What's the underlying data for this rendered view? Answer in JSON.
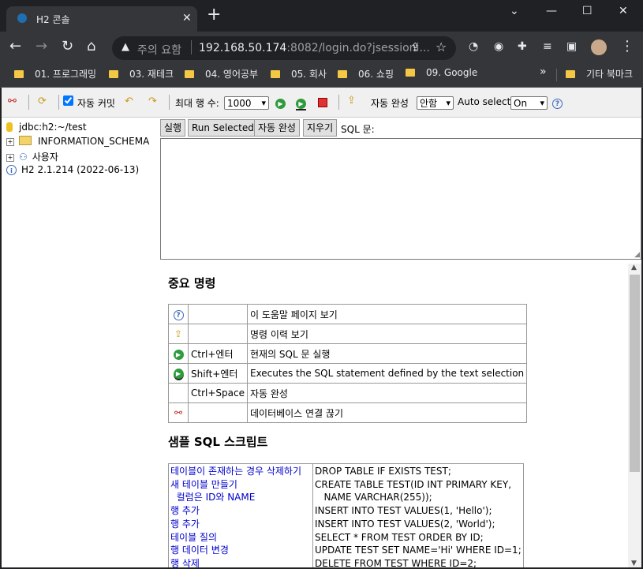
{
  "browser": {
    "tab_title": "H2 콘솔",
    "url_prefix": "주의 요함",
    "url_host": "192.168.50.174",
    "url_rest": ":8082/login.do?jsessioni...",
    "bookmarks": [
      "01. 프로그래밍",
      "03. 재테크",
      "04. 영어공부",
      "05. 회사",
      "06. 쇼핑",
      "09. Google"
    ],
    "other_bookmarks": "기타 북마크"
  },
  "h2toolbar": {
    "autocommit_label": "자동 커밋",
    "max_rows_label": "최대 행 수:",
    "max_rows_value": "1000",
    "autocomplete_label": "자동 완성",
    "autocomplete_value": "안함",
    "autoselect_label": "Auto select",
    "autoselect_value": "On"
  },
  "tree": {
    "connection": "jdbc:h2:~/test",
    "schema": "INFORMATION_SCHEMA",
    "users": "사용자",
    "version": "H2 2.1.214 (2022-06-13)"
  },
  "query": {
    "run": "실행",
    "run_selected": "Run Selected",
    "autocomplete": "자동 완성",
    "clear": "지우기",
    "sql_label": "SQL 문:"
  },
  "help": {
    "important_title": "중요 명령",
    "commands": [
      {
        "key": "",
        "desc": "이 도움말 페이지 보기"
      },
      {
        "key": "",
        "desc": "명령 이력 보기"
      },
      {
        "key": "Ctrl+엔터",
        "desc": "현재의 SQL 문 실행"
      },
      {
        "key": "Shift+엔터",
        "desc": "Executes the SQL statement defined by the text selection"
      },
      {
        "key": "Ctrl+Space",
        "desc": "자동 완성"
      },
      {
        "key": "",
        "desc": "데이터베이스 연결 끊기"
      }
    ],
    "sample_title": "샘플 SQL 스크립트",
    "sample_links": [
      "테이블이 존재하는 경우 삭제하기",
      "새 테이블 만들기",
      "  컬럼은 ID와 NAME",
      "행 추가",
      "행 추가",
      "테이블 질의",
      "행 데이터 변경",
      "행 삭제"
    ],
    "sample_code": [
      "DROP TABLE IF EXISTS TEST;",
      "CREATE TABLE TEST(ID INT PRIMARY KEY,",
      "   NAME VARCHAR(255));",
      "INSERT INTO TEST VALUES(1, 'Hello');",
      "INSERT INTO TEST VALUES(2, 'World');",
      "SELECT * FROM TEST ORDER BY ID;",
      "UPDATE TEST SET NAME='Hi' WHERE ID=1;",
      "DELETE FROM TEST WHERE ID=2;"
    ]
  }
}
